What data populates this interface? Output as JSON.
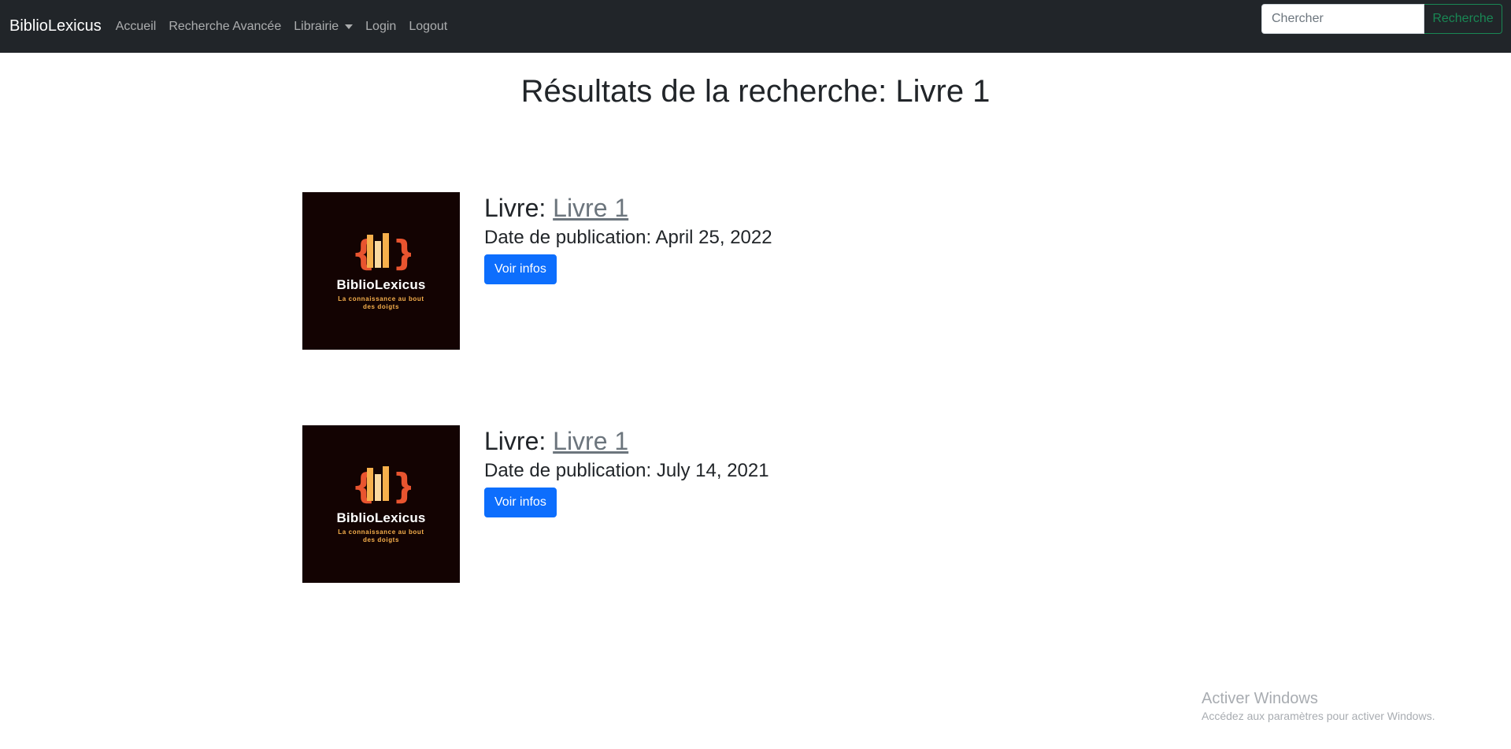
{
  "navbar": {
    "brand": "BiblioLexicus",
    "links": [
      "Accueil",
      "Recherche Avancée",
      "Librairie",
      "Login",
      "Logout"
    ],
    "search": {
      "placeholder": "Chercher",
      "button_label": "Recherche"
    }
  },
  "page": {
    "title": "Résultats de la recherche: Livre 1"
  },
  "results": [
    {
      "book_prefix": "Livre: ",
      "book_title": "Livre 1",
      "date_text": "Date de publication: April 25, 2022",
      "button_label": "Voir infos",
      "cover": {
        "logo_name": "BiblioLexicus",
        "logo_tagline": "La connaissance au bout des doigts"
      }
    },
    {
      "book_prefix": "Livre: ",
      "book_title": "Livre 1",
      "date_text": "Date de publication: July 14, 2021",
      "button_label": "Voir infos",
      "cover": {
        "logo_name": "BiblioLexicus",
        "logo_tagline": "La connaissance au bout des doigts"
      }
    }
  ],
  "watermark": {
    "title": "Activer Windows",
    "subtitle": "Accédez aux paramètres pour activer Windows."
  },
  "colors": {
    "navbar_bg": "#212529",
    "primary": "#0d6efd",
    "success": "#198754",
    "cover_bg": "#130302",
    "logo_orange": "#e8542f",
    "logo_yellow": "#f7b04c"
  }
}
